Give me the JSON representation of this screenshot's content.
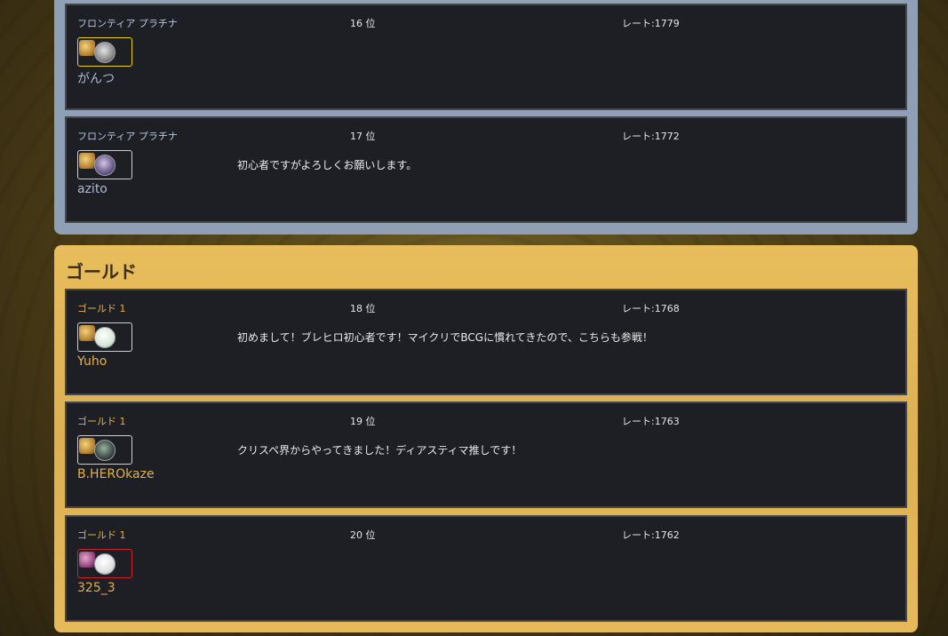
{
  "sections": [
    {
      "title": "",
      "entries": [
        {
          "rank_label": "フロンティア プラチナ",
          "position": "16 位",
          "rate": "レート:1779",
          "player": "がんつ",
          "comment": ""
        },
        {
          "rank_label": "フロンティア プラチナ",
          "position": "17 位",
          "rate": "レート:1772",
          "player": "azito",
          "comment": "初心者ですがよろしくお願いします。"
        }
      ]
    },
    {
      "title": "ゴールド",
      "entries": [
        {
          "rank_label": "ゴールド 1",
          "position": "18 位",
          "rate": "レート:1768",
          "player": "Yuho",
          "comment": "初めまして！ブレヒロ初心者です！マイクリでBCGに慣れてきたので、こちらも参戦！"
        },
        {
          "rank_label": "ゴールド 1",
          "position": "19 位",
          "rate": "レート:1763",
          "player": "B.HEROkaze",
          "comment": "クリスペ界からやってきました！ディアスティマ推しです！"
        },
        {
          "rank_label": "ゴールド 1",
          "position": "20 位",
          "rate": "レート:1762",
          "player": "325_3",
          "comment": ""
        }
      ]
    }
  ],
  "colors": {
    "platinum_panel": "#8f9fb6",
    "gold_panel": "#e2b556",
    "card_bg": "#1d1f24",
    "gold_text": "#e2b04e",
    "platinum_text": "#a9bad3"
  }
}
